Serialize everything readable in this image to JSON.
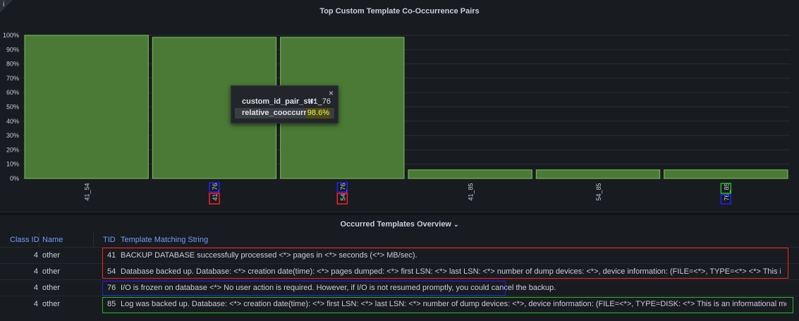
{
  "chart_panel": {
    "title": "Top Custom Template Co-Occurrence Pairs",
    "info_icon": "i"
  },
  "chart_data": {
    "type": "bar",
    "title": "Top Custom Template Co-Occurrence Pairs",
    "categories": [
      "41_54",
      "41_76",
      "54_76",
      "41_85",
      "54_85",
      "76_85"
    ],
    "values": [
      100,
      98.6,
      98.6,
      6,
      6,
      6
    ],
    "ylim": [
      0,
      100
    ],
    "yticks": [
      "0%",
      "10%",
      "20%",
      "30%",
      "40%",
      "50%",
      "60%",
      "70%",
      "80%",
      "90%",
      "100%"
    ],
    "grid": true,
    "bar_color": "#4a7a36",
    "bar_border": "#7ac45a"
  },
  "tooltip": {
    "close_glyph": "×",
    "rows": [
      {
        "key": "custom_id_pair_str:",
        "value": "41_76"
      },
      {
        "key": "relative_cooccurrence:",
        "value": "98.6%"
      }
    ]
  },
  "table_panel": {
    "title": "Occurred Templates Overview",
    "title_chevron": "⌄",
    "headers": {
      "class_id": "Class ID",
      "name": "Name",
      "tid": "TID",
      "template": "Template Matching String"
    },
    "rows": [
      {
        "class_id": "4",
        "name": "other",
        "tid": "41",
        "template": "BACKUP DATABASE successfully processed <*> pages in <*> seconds (<*> MB/sec)."
      },
      {
        "class_id": "4",
        "name": "other",
        "tid": "54",
        "template": "Database backed up. Database: <*> creation date(time): <*> pages dumped: <*> first LSN: <*> last LSN: <*> number of dump devices: <*>, device information: (FILE=<*>, TYPE=<*> <*> This is an informational message only. ..."
      },
      {
        "class_id": "4",
        "name": "other",
        "tid": "76",
        "template": "I/O is frozen on database <*> No user action is required. However, if I/O is not resumed promptly, you could cancel the backup."
      },
      {
        "class_id": "4",
        "name": "other",
        "tid": "85",
        "template": "Log was backed up. Database: <*> creation date(time): <*> first LSN: <*> last LSN: <*> number of dump devices: <*>, device information: (FILE=<*>, TYPE=DISK: <*> This is an informational message only. No user action is re..."
      }
    ]
  },
  "colors": {
    "red_box": "#ff2020",
    "blue_box": "#2020ff",
    "green_box": "#20c020",
    "header_link": "#6e9fff"
  }
}
